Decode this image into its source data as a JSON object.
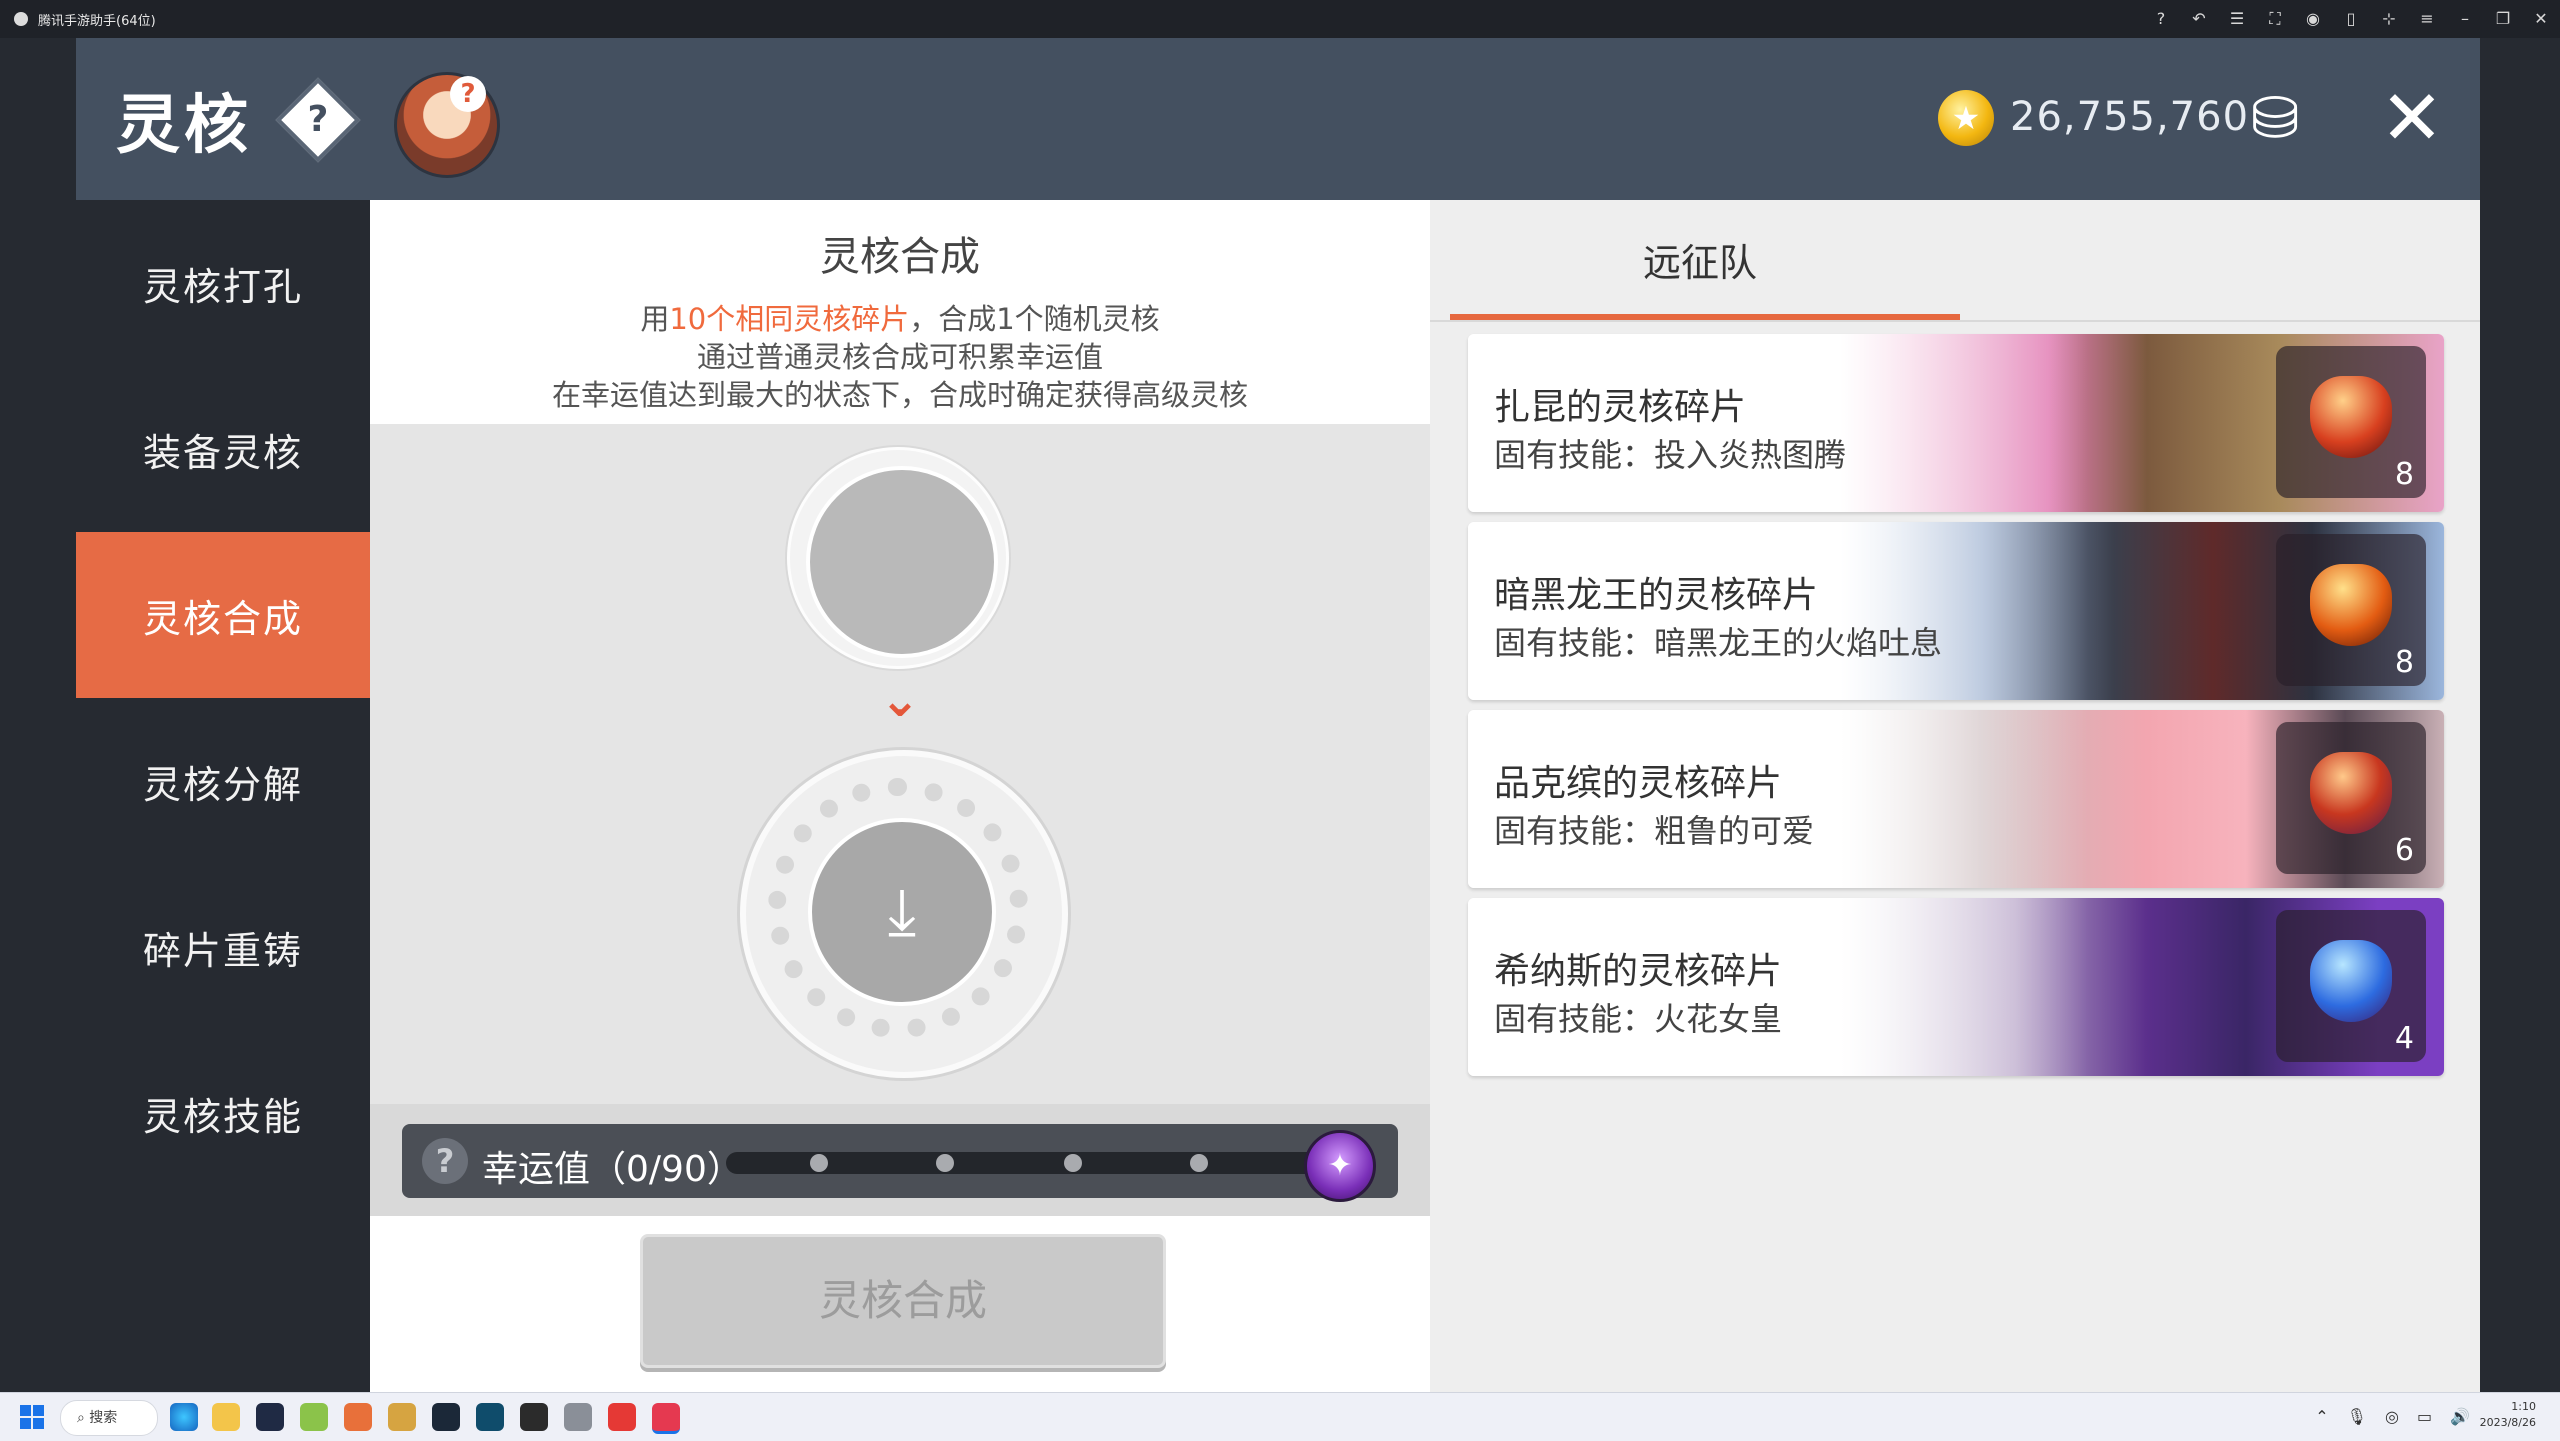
{
  "window": {
    "title": "腾讯手游助手(64位)",
    "controls": [
      "help-icon",
      "undo-icon",
      "list-icon",
      "fullscreen-icon",
      "account-icon",
      "layout-icon",
      "pin-icon",
      "menu-icon",
      "minimize-icon",
      "restore-icon",
      "close-icon"
    ]
  },
  "header": {
    "title": "灵核",
    "help_glyph": "?",
    "mascot_badge": "?",
    "coin_amount": "26,755,760",
    "close_glyph": "✕"
  },
  "sidebar": {
    "items": [
      {
        "label": "灵核打孔",
        "active": false
      },
      {
        "label": "装备灵核",
        "active": false
      },
      {
        "label": "灵核合成",
        "active": true
      },
      {
        "label": "灵核分解",
        "active": false
      },
      {
        "label": "碎片重铸",
        "active": false
      },
      {
        "label": "灵核技能",
        "active": false
      }
    ]
  },
  "synthesis": {
    "title": "灵核合成",
    "desc_prefix": "用",
    "desc_highlight": "10个相同灵核碎片",
    "desc_suffix": "，合成1个随机灵核",
    "desc_line2": "通过普通灵核合成可积累幸运值",
    "desc_line3": "在幸运值达到最大的状态下，合成时确定获得高级灵核",
    "luck_label": "幸运值（0/90）",
    "luck_value": 0,
    "luck_max": 90,
    "button_label": "灵核合成"
  },
  "right_panel": {
    "tab_label": "远征队",
    "cards": [
      {
        "name": "扎昆的灵核碎片",
        "skill": "固有技能：投入炎热图腾",
        "count": "8",
        "gem_color": "#d8401f"
      },
      {
        "name": "暗黑龙王的灵核碎片",
        "skill": "固有技能：暗黑龙王的火焰吐息",
        "count": "8",
        "gem_color": "#e35c12"
      },
      {
        "name": "品克缤的灵核碎片",
        "skill": "固有技能：粗鲁的可爱",
        "count": "6",
        "gem_color": "#c8371f"
      },
      {
        "name": "希纳斯的灵核碎片",
        "skill": "固有技能：火花女皇",
        "count": "4",
        "gem_color": "#2d6be0"
      }
    ]
  },
  "taskbar": {
    "search_label": "搜索",
    "time": "1:10",
    "date": "2023/8/26"
  },
  "colors": {
    "accent": "#e66b45",
    "header_bg": "#445060",
    "sidebar_bg": "#262a31"
  }
}
